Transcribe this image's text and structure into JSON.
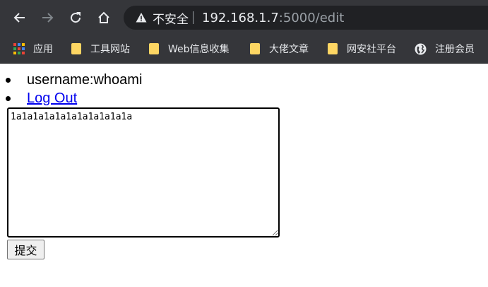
{
  "browser": {
    "address_bar": {
      "security_label": "不安全",
      "url_host": "192.168.1.7",
      "url_rest": ":5000/edit"
    },
    "nav_icons": [
      "back-icon",
      "forward-icon",
      "reload-icon",
      "home-icon"
    ],
    "bookmarks": [
      {
        "label": "应用",
        "icon": "apps-grid-icon"
      },
      {
        "label": "工具网站",
        "icon": "folder-icon"
      },
      {
        "label": "Web信息收集",
        "icon": "folder-icon"
      },
      {
        "label": "大佬文章",
        "icon": "folder-icon"
      },
      {
        "label": "网安社平台",
        "icon": "folder-icon"
      },
      {
        "label": "注册会员",
        "icon": "globe-icon"
      }
    ],
    "colors": {
      "toolbar_bg": "#35363a",
      "omnibox_bg": "#202124",
      "folder_yellow": "#fdd663"
    }
  },
  "page": {
    "user_items": {
      "username_text": "username:whoami",
      "logout_link": "Log Out"
    },
    "editor": {
      "value": "1a1a1a1a1a1a1a1a1a1a1a"
    },
    "submit_label": "提交",
    "link_color": "#0000ee"
  }
}
